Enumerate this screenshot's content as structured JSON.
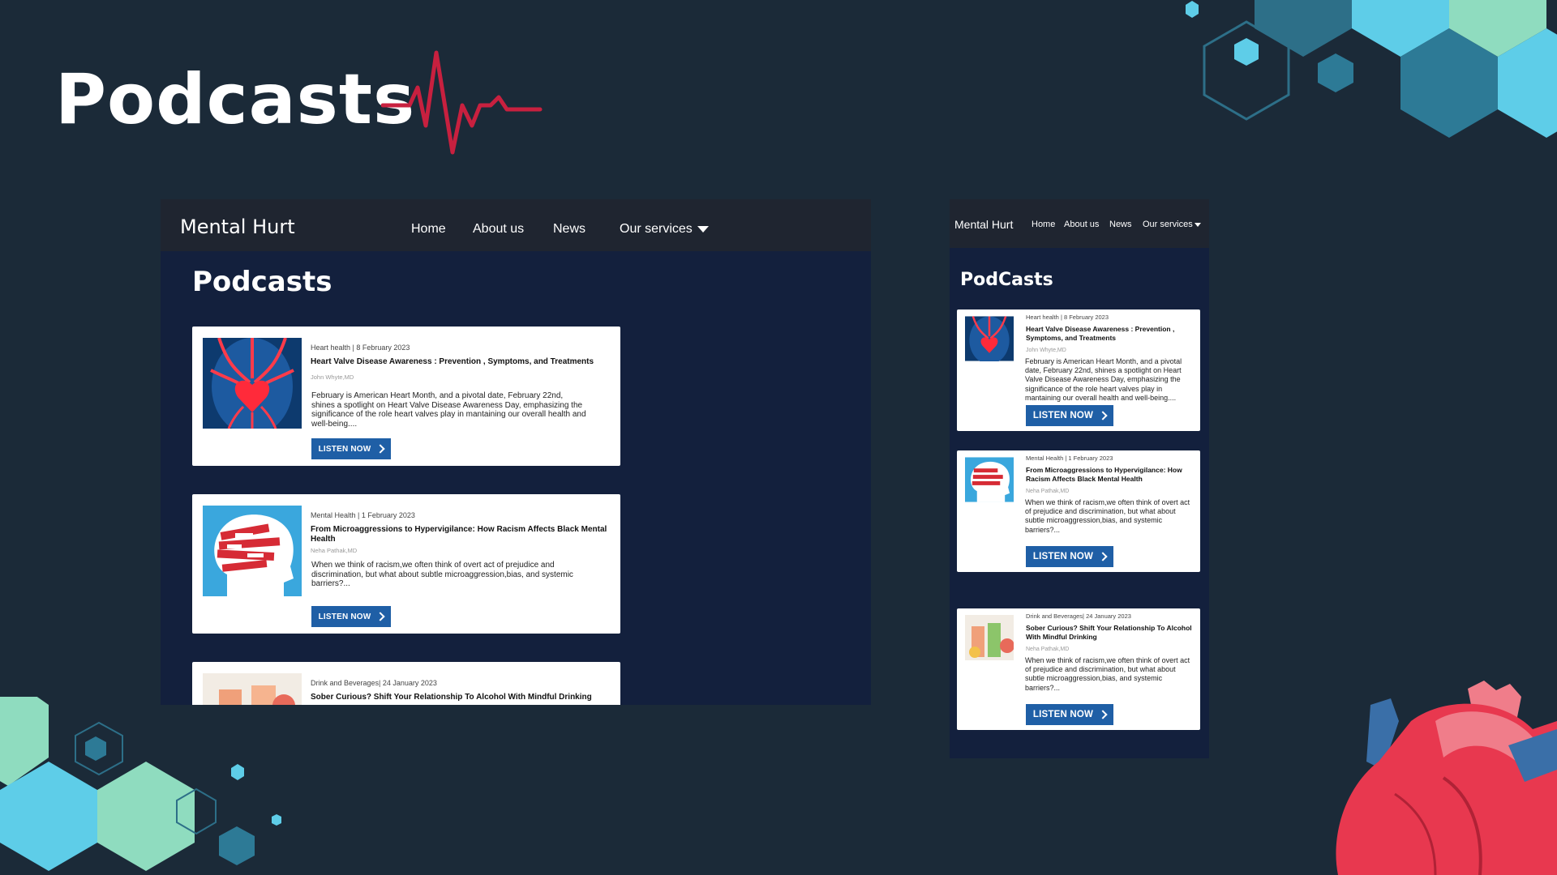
{
  "slide": {
    "title": "Podcasts"
  },
  "desktop": {
    "brand": "Mental Hurt",
    "nav": [
      "Home",
      "About us",
      "News",
      "Our services"
    ],
    "heading": "Podcasts",
    "cards": [
      {
        "meta": "Heart health | 8 February 2023",
        "title": "Heart Valve Disease Awareness : Prevention , Symptoms, and Treatments",
        "author": "John Whyte,MD",
        "desc": "February is American Heart Month, and a pivotal date, February 22nd, shines a spotlight on Heart Valve Disease Awareness Day, emphasizing the significance of the role heart valves play in mantaining our overall health and well-being....",
        "button": "LISTEN NOW"
      },
      {
        "meta": "Mental Health | 1 February 2023",
        "title": "From Microaggressions to Hypervigilance: How Racism Affects Black Mental Health",
        "author": "Neha Pathak,MD",
        "desc": "When we think of racism,we often think of overt act of prejudice and discrimination, but what about subtle microaggression,bias, and systemic barriers?...",
        "button": "LISTEN NOW"
      },
      {
        "meta": "Drink and Beverages| 24 January 2023",
        "title": "Sober Curious? Shift Your Relationship To Alcohol With Mindful Drinking"
      }
    ]
  },
  "mobile": {
    "brand": "Mental Hurt",
    "nav": [
      "Home",
      "About us",
      "News",
      "Our services"
    ],
    "heading": "PodCasts",
    "cards": [
      {
        "meta": "Heart health | 8 February 2023",
        "title": "Heart Valve Disease Awareness : Prevention , Symptoms, and Treatments",
        "author": "John Whyte,MD",
        "desc": "February is American Heart Month, and a pivotal date, February 22nd, shines a spotlight on Heart Valve Disease Awareness Day, emphasizing the significance of the role heart valves play in mantaining our overall health and well-being....",
        "button": "LISTEN NOW"
      },
      {
        "meta": "Mental Health | 1 February 2023",
        "title": "From Microaggressions to Hypervigilance: How Racism Affects Black Mental Health",
        "author": "Neha Pathak,MD",
        "desc": "When we think of racism,we often think of overt act of prejudice and discrimination, but what about subtle microaggression,bias, and systemic barriers?...",
        "button": "LISTEN NOW"
      },
      {
        "meta": "Drink and Beverages| 24 January 2023",
        "title": "Sober Curious? Shift Your Relationship To Alcohol With Mindful Drinking",
        "author": "Neha Pathak,MD",
        "desc": "When we think of racism,we often think of overt act of prejudice and discrimination, but what about subtle microaggression,bias, and systemic barriers?...",
        "button": "LISTEN NOW"
      }
    ]
  },
  "colors": {
    "background": "#1b2a38",
    "panel": "#13203d",
    "navbar": "#1f2530",
    "button": "#1f5fa6",
    "pulse": "#c8203f",
    "hex_light": "#5ecde8",
    "hex_mid": "#2d7a96",
    "hex_green": "#8fdcbf",
    "heart_red": "#e8384f"
  },
  "icons": [
    "heartbeat-pulse-icon",
    "chevron-right-icon",
    "caret-down-icon",
    "heart-illustration-icon"
  ]
}
